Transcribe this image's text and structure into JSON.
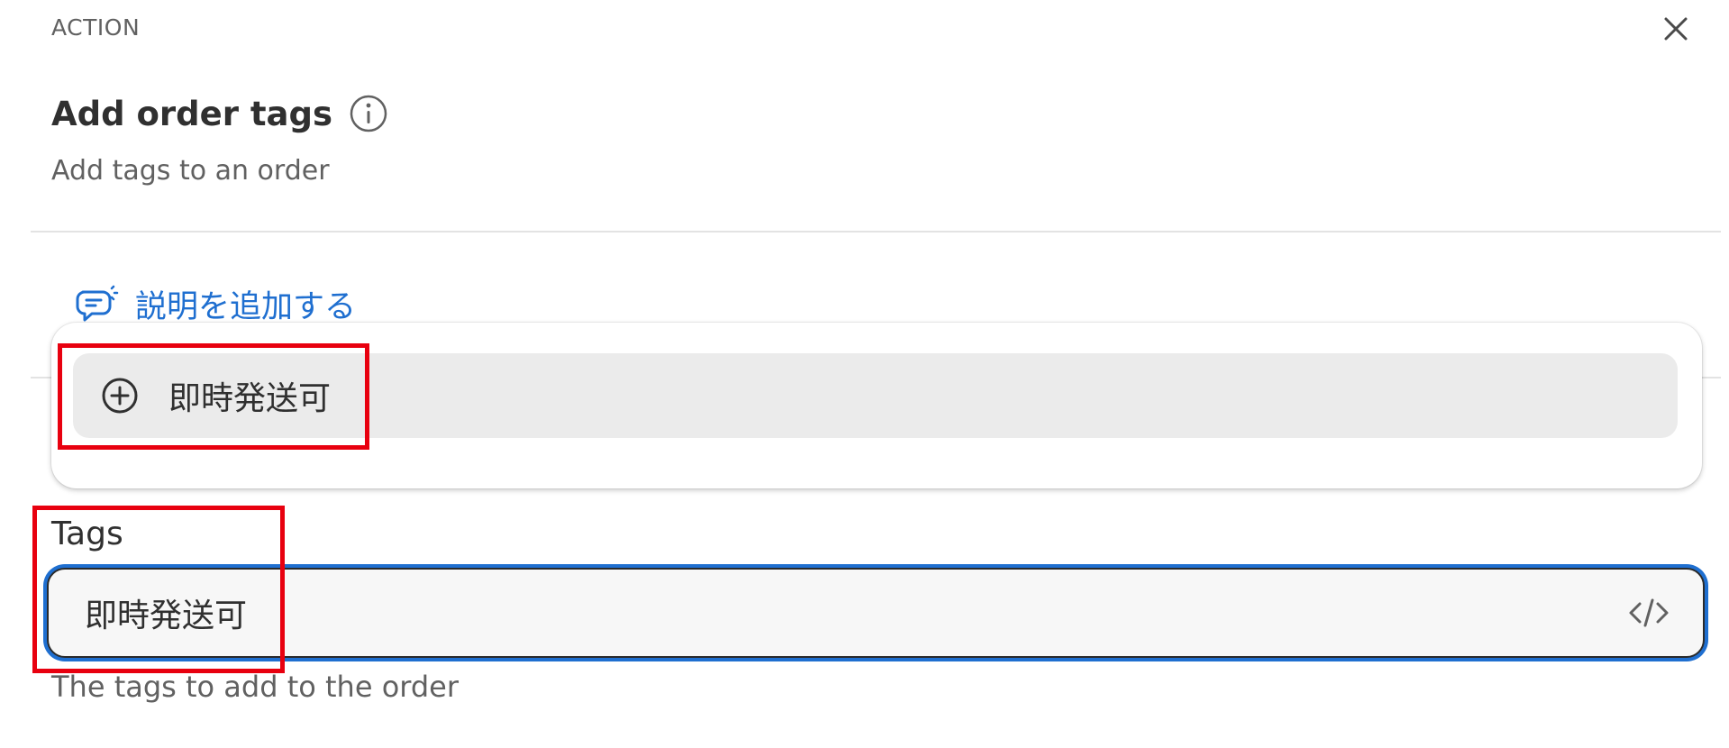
{
  "header": {
    "section_label": "ACTION",
    "title": "Add order tags",
    "subtitle": "Add tags to an order"
  },
  "add_description": {
    "label": "説明を追加する"
  },
  "dropdown": {
    "options": [
      {
        "label": "即時発送可"
      }
    ]
  },
  "tags_field": {
    "label": "Tags",
    "value": "即時発送可",
    "help_text": "The tags to add to the order"
  },
  "icons": {
    "close": "close-icon",
    "info": "info-icon",
    "comment": "comment-icon",
    "plus": "plus-circle-icon",
    "code": "code-icon"
  },
  "colors": {
    "link_blue": "#1f6fd0",
    "highlight_red": "#e8000f",
    "focus_ring": "#1f6fd0"
  }
}
